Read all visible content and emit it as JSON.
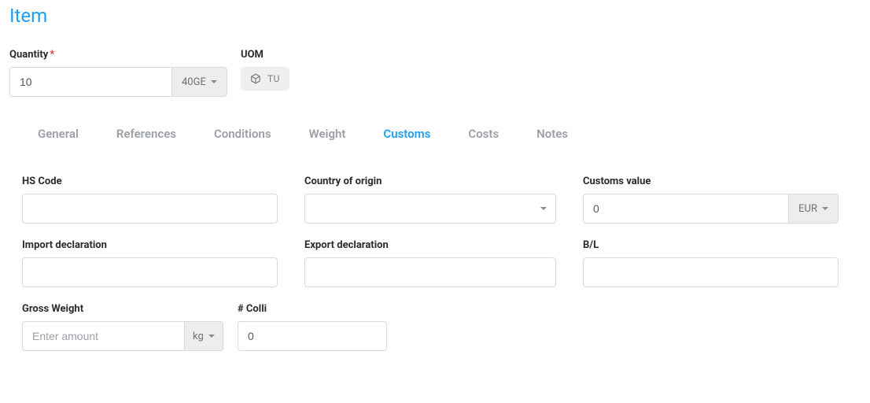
{
  "page": {
    "title": "Item"
  },
  "top": {
    "quantity_label": "Quantity",
    "quantity_value": "10",
    "quantity_unit_selected": "40GE",
    "uom_label": "UOM",
    "uom_value": "TU"
  },
  "tabs": {
    "general": "General",
    "references": "References",
    "conditions": "Conditions",
    "weight": "Weight",
    "customs": "Customs",
    "costs": "Costs",
    "notes": "Notes",
    "active": "customs"
  },
  "customs": {
    "hs_code_label": "HS Code",
    "hs_code_value": "",
    "country_label": "Country of origin",
    "country_value": "",
    "customs_value_label": "Customs value",
    "customs_value_value": "0",
    "customs_value_currency": "EUR",
    "import_decl_label": "Import declaration",
    "import_decl_value": "",
    "export_decl_label": "Export declaration",
    "export_decl_value": "",
    "bl_label": "B/L",
    "bl_value": "",
    "gross_weight_label": "Gross Weight",
    "gross_weight_placeholder": "Enter amount",
    "gross_weight_value": "",
    "gross_weight_unit": "kg",
    "colli_label": "# Colli",
    "colli_value": "0"
  }
}
